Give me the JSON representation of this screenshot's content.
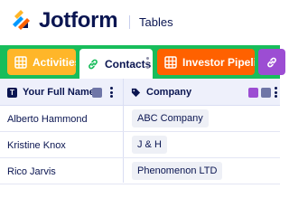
{
  "header": {
    "brand": "Jotform",
    "section": "Tables",
    "logo_icon": "jotform-logo-icon"
  },
  "tabs": [
    {
      "label": "Activities",
      "color": "#ffb629",
      "icon": "table-grid-icon",
      "active": false
    },
    {
      "label": "Contacts",
      "color": "#ffffff",
      "icon": "link-icon",
      "active": true
    },
    {
      "label": "Investor Pipeline",
      "color": "#ff6100",
      "icon": "table-grid-icon",
      "active": false
    },
    {
      "label": "",
      "color": "#9c4dd3",
      "icon": "link-icon",
      "active": false
    }
  ],
  "tabbar_color": "#18bd5b",
  "table": {
    "columns": [
      {
        "label": "Your Full Name",
        "icon": "text-type-icon"
      },
      {
        "label": "Company",
        "icon": "tag-icon"
      }
    ],
    "rows": [
      {
        "name": "Alberto Hammond",
        "company": "ABC Company"
      },
      {
        "name": "Kristine Knox",
        "company": "J & H"
      },
      {
        "name": "Rico Jarvis",
        "company": "Phenomenon LTD"
      }
    ]
  }
}
